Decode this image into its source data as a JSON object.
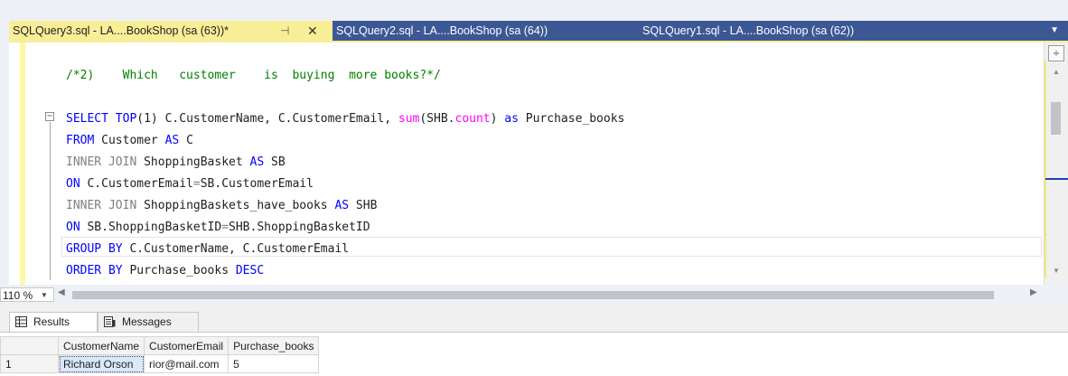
{
  "tabs": [
    {
      "label": "SQLQuery3.sql - LA....BookShop (sa (63))*",
      "active": true
    },
    {
      "label": "SQLQuery2.sql - LA....BookShop (sa (64))",
      "active": false
    },
    {
      "label": "SQLQuery1.sql - LA....BookShop (sa (62))",
      "active": false
    }
  ],
  "editor": {
    "comment": "/*2)    Which   customer    is  buying  more books?*/",
    "lines": [
      {
        "parts": [
          [
            "k-blue",
            "SELECT TOP"
          ],
          [
            "",
            "(1) C.CustomerName, C.CustomerEmail, "
          ],
          [
            "k-pink",
            "sum"
          ],
          [
            "",
            "(SHB."
          ],
          [
            "k-pink",
            "count"
          ],
          [
            "",
            ") "
          ],
          [
            "k-blue",
            "as"
          ],
          [
            "",
            " Purchase_books"
          ]
        ]
      },
      {
        "parts": [
          [
            "k-blue",
            "FROM"
          ],
          [
            "",
            " Customer "
          ],
          [
            "k-blue",
            "AS"
          ],
          [
            "",
            " C"
          ]
        ]
      },
      {
        "parts": [
          [
            "k-gray",
            "INNER JOIN"
          ],
          [
            "",
            " ShoppingBasket "
          ],
          [
            "k-blue",
            "AS"
          ],
          [
            "",
            " SB"
          ]
        ]
      },
      {
        "parts": [
          [
            "k-blue",
            "ON"
          ],
          [
            "",
            " C.CustomerEmail"
          ],
          [
            "k-gray",
            "="
          ],
          [
            "",
            "SB.CustomerEmail"
          ]
        ]
      },
      {
        "parts": [
          [
            "k-gray",
            "INNER JOIN"
          ],
          [
            "",
            " ShoppingBaskets_have_books "
          ],
          [
            "k-blue",
            "AS"
          ],
          [
            "",
            " SHB"
          ]
        ]
      },
      {
        "parts": [
          [
            "k-blue",
            "ON"
          ],
          [
            "",
            " SB.ShoppingBasketID"
          ],
          [
            "k-gray",
            "="
          ],
          [
            "",
            "SHB.ShoppingBasketID"
          ]
        ]
      },
      {
        "parts": [
          [
            "k-blue",
            "GROUP BY"
          ],
          [
            "",
            " C.CustomerName, C.CustomerEmail"
          ]
        ]
      },
      {
        "parts": [
          [
            "k-blue",
            "ORDER BY"
          ],
          [
            "",
            " Purchase_books "
          ],
          [
            "k-blue",
            "DESC"
          ]
        ]
      }
    ]
  },
  "zoom": {
    "value": "110 %"
  },
  "results_panel": {
    "tabs": [
      "Results",
      "Messages"
    ],
    "columns": [
      "CustomerName",
      "CustomerEmail",
      "Purchase_books"
    ],
    "rows": [
      {
        "num": "1",
        "cells": [
          "Richard Orson",
          "rior@mail.com",
          "5"
        ]
      }
    ]
  }
}
